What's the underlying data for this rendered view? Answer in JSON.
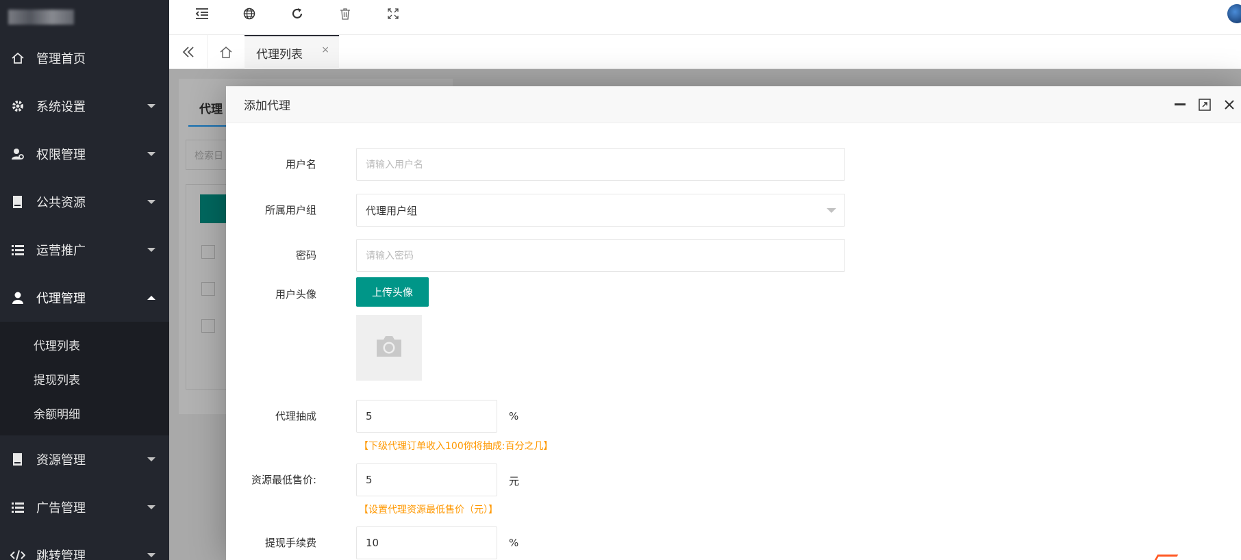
{
  "sidebar": {
    "items": [
      {
        "label": "管理首页",
        "icon": "home-icon",
        "has_caret": false
      },
      {
        "label": "系统设置",
        "icon": "gear-icon",
        "has_caret": true
      },
      {
        "label": "权限管理",
        "icon": "user-key-icon",
        "has_caret": true
      },
      {
        "label": "公共资源",
        "icon": "book-icon",
        "has_caret": true
      },
      {
        "label": "运营推广",
        "icon": "list-icon",
        "has_caret": true
      },
      {
        "label": "代理管理",
        "icon": "user-icon",
        "has_caret": true,
        "expanded": true
      },
      {
        "label": "资源管理",
        "icon": "book-icon",
        "has_caret": true
      },
      {
        "label": "广告管理",
        "icon": "list-icon",
        "has_caret": true
      },
      {
        "label": "跳转管理",
        "icon": "code-icon",
        "has_caret": true
      }
    ],
    "subitems": [
      "代理列表",
      "提现列表",
      "余额明细"
    ]
  },
  "toolbar": {
    "icons": [
      "menu-indent-icon",
      "globe-icon",
      "refresh-icon",
      "trash-icon",
      "fullscreen-icon"
    ]
  },
  "tabs": {
    "active_label": "代理列表",
    "close_glyph": "×"
  },
  "background_page": {
    "tab_label": "代理",
    "search_placeholder": "检索日"
  },
  "modal": {
    "title": "添加代理",
    "fields": {
      "username": {
        "label": "用户名",
        "placeholder": "请输入用户名"
      },
      "group": {
        "label": "所属用户组",
        "value": "代理用户组"
      },
      "password": {
        "label": "密码",
        "placeholder": "请输入密码"
      },
      "avatar": {
        "label": "用户头像",
        "button": "上传头像"
      },
      "commission": {
        "label": "代理抽成",
        "value": "5",
        "unit": "%",
        "tip": "【下级代理订单收入100你将抽成:百分之几】"
      },
      "min_price": {
        "label": "资源最低售价:",
        "value": "5",
        "unit": "元",
        "tip": "【设置代理资源最低售价（元）】"
      },
      "withdraw_fee": {
        "label": "提现手续费",
        "value": "10",
        "unit": "%"
      }
    }
  },
  "colors": {
    "sidebar_bg": "#23262e",
    "primary": "#009688",
    "tip": "#ff9800"
  }
}
